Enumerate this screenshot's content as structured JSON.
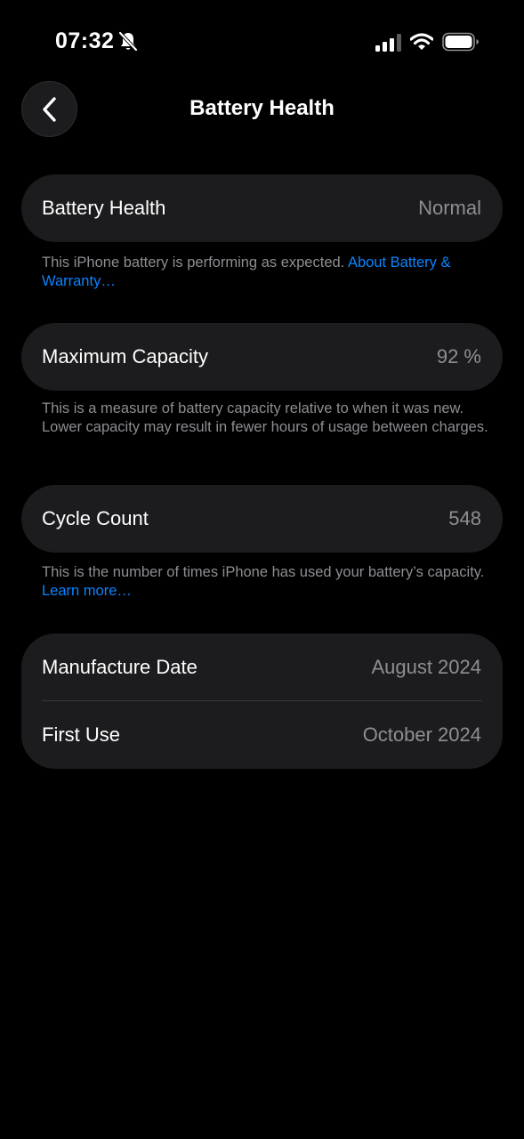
{
  "status_bar": {
    "time": "07:32"
  },
  "nav": {
    "title": "Battery Health"
  },
  "battery_health": {
    "label": "Battery Health",
    "value": "Normal",
    "footnote_text": "This iPhone battery is performing as expected. ",
    "footnote_link": "About Battery & Warranty…"
  },
  "maximum_capacity": {
    "label": "Maximum Capacity",
    "value": "92 %",
    "footnote_text": "This is a measure of battery capacity relative to when it was new. Lower capacity may result in fewer hours of usage between charges."
  },
  "cycle_count": {
    "label": "Cycle Count",
    "value": "548",
    "footnote_text": "This is the number of times iPhone has used your battery’s capacity. ",
    "footnote_link": "Learn more…"
  },
  "dates": {
    "manufacture_label": "Manufacture Date",
    "manufacture_value": "August 2024",
    "first_use_label": "First Use",
    "first_use_value": "October 2024"
  },
  "colors": {
    "background": "#000000",
    "card": "#1c1c1e",
    "secondary_text": "#8e8e93",
    "link": "#0a84ff"
  }
}
